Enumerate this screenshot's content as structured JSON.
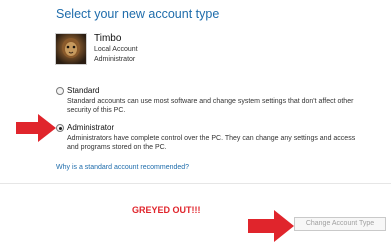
{
  "heading": "Select your new account type",
  "user": {
    "name": "Timbo",
    "account_type": "Local Account",
    "role": "Administrator"
  },
  "options": [
    {
      "label": "Standard",
      "selected": false,
      "description_lines": [
        "Standard accounts can use most software and change system settings that don't affect other",
        "security of this PC."
      ]
    },
    {
      "label": "Administrator",
      "selected": true,
      "description_lines": [
        "Administrators have complete control over the PC. They can change any settings and access",
        "and programs stored on the PC."
      ]
    }
  ],
  "help_link": "Why is a standard account recommended?",
  "annotation": "GREYED OUT!!!",
  "change_button": {
    "label": "Change Account Type",
    "enabled": false
  },
  "colors": {
    "link": "#1e6cab",
    "annotation": "#e0252c",
    "arrow": "#e0252c"
  },
  "icons": {
    "arrow": "red-arrow-icon",
    "avatar": "user-avatar"
  }
}
